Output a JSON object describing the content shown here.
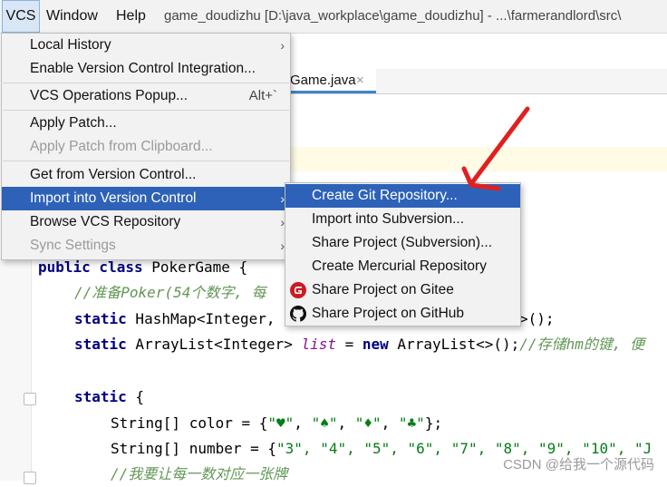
{
  "menubar": {
    "vcs": "VCS",
    "window": "Window",
    "help": "Help",
    "title": "game_doudizhu [D:\\java_workplace\\game_doudizhu] - ...\\farmerandlord\\src\\"
  },
  "editor": {
    "tab_label": "Game.java",
    "tab_close": "×",
    "code": {
      "l1_kw": "public class",
      "l1_rest": " PokerGame {",
      "l2_comment": "//准备Poker(54个数字, 每",
      "l3_kw": "static",
      "l3_rest": " HashMap<Integer,",
      "l3_tail": ">();",
      "l4_kw": "static",
      "l4_type": " ArrayList<Integer> ",
      "l4_field": "list",
      "l4_eq": " = ",
      "l4_new": "new",
      "l4_rest": " ArrayList<>();",
      "l4_comment": "//存储hm的键, 便",
      "l5_kw": "static",
      "l5_rest": " {",
      "l6_type": "String[] color = {",
      "l6_s1": "\"♥\"",
      "l6_s2": "\"♠\"",
      "l6_s3": "\"♦\"",
      "l6_s4": "\"♣\"",
      "l6_end": "};",
      "l6_sep": ", ",
      "l7_type": "String[] number = {",
      "l7_values": "\"3\", \"4\", \"5\", \"6\", \"7\", \"8\", \"9\", \"10\", \"J",
      "l8_comment": "//我要让每一数对应一张牌"
    }
  },
  "vcs_menu": {
    "items": [
      {
        "label": "Local History",
        "arrow": "›"
      },
      {
        "label": "Enable Version Control Integration..."
      },
      {
        "label": "VCS Operations Popup...",
        "shortcut": "Alt+`"
      },
      {
        "label": "Apply Patch..."
      },
      {
        "label": "Apply Patch from Clipboard...",
        "disabled": true
      },
      {
        "label": "Get from Version Control..."
      },
      {
        "label": "Import into Version Control",
        "arrow": "›",
        "selected": true
      },
      {
        "label": "Browse VCS Repository",
        "arrow": "›"
      },
      {
        "label": "Sync Settings",
        "arrow": "›",
        "disabled": true
      }
    ]
  },
  "submenu": {
    "items": [
      {
        "label": "Create Git Repository...",
        "selected": true
      },
      {
        "label": "Import into Subversion..."
      },
      {
        "label": "Share Project (Subversion)..."
      },
      {
        "label": "Create Mercurial Repository"
      },
      {
        "label": "Share Project on Gitee",
        "icon": "gitee-icon"
      },
      {
        "label": "Share Project on GitHub",
        "icon": "github-icon"
      }
    ]
  },
  "watermark": "CSDN @给我一个源代码",
  "colors": {
    "selection": "#2d62b8",
    "annotation_arrow": "#e02020",
    "gitee": "#c71d23"
  }
}
